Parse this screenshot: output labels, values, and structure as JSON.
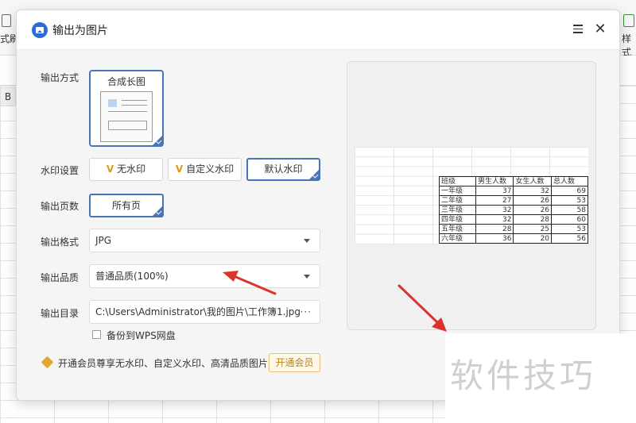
{
  "background": {
    "toolbar_left_label": "式刷",
    "toolbar_right_label": "样式",
    "column_header": "B"
  },
  "dialog": {
    "title": "输出为图片",
    "labels": {
      "output_mode": "输出方式",
      "watermark": "水印设置",
      "pages": "输出页数",
      "format": "输出格式",
      "quality": "输出品质",
      "directory": "输出目录"
    },
    "output_mode_option": "合成长图",
    "watermark_options": [
      "无水印",
      "自定义水印",
      "默认水印"
    ],
    "watermark_selected": "默认水印",
    "pages_option": "所有页",
    "format_value": "JPG",
    "quality_value": "普通品质(100%)",
    "directory_value": "C:\\Users\\Administrator\\我的图片\\工作簿1.jpg",
    "directory_more": "···",
    "backup_label": "备份到WPS网盘",
    "vip_text": "开通会员尊享无水印、自定义水印、高清品质图片",
    "vip_button": "开通会员"
  },
  "preview_table": {
    "headers": [
      "班级",
      "男生人数",
      "女生人数",
      "总人数"
    ],
    "rows": [
      [
        "一年级",
        "37",
        "32",
        "69"
      ],
      [
        "二年级",
        "27",
        "26",
        "53"
      ],
      [
        "三年级",
        "32",
        "26",
        "58"
      ],
      [
        "四年级",
        "32",
        "28",
        "60"
      ],
      [
        "五年级",
        "28",
        "25",
        "53"
      ],
      [
        "六年级",
        "36",
        "20",
        "56"
      ]
    ]
  },
  "watermark_overlay": "软件技巧",
  "colors": {
    "accent": "#4a74b8",
    "arrow": "#d9342b",
    "vip": "#e2a732"
  }
}
